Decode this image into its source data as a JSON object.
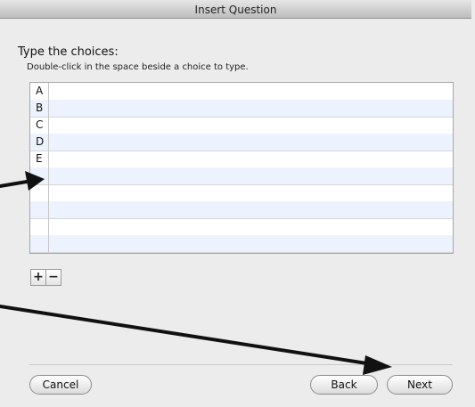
{
  "window": {
    "title": "Insert Question"
  },
  "prompt": {
    "heading": "Type the choices:",
    "subheading": "Double-click in the space beside a choice to type."
  },
  "choices": {
    "letters": [
      "A",
      "B",
      "C",
      "D",
      "E",
      "",
      "",
      "",
      "",
      ""
    ]
  },
  "row_buttons": {
    "add": "+",
    "remove": "−"
  },
  "footer": {
    "cancel": "Cancel",
    "back": "Back",
    "next": "Next"
  }
}
